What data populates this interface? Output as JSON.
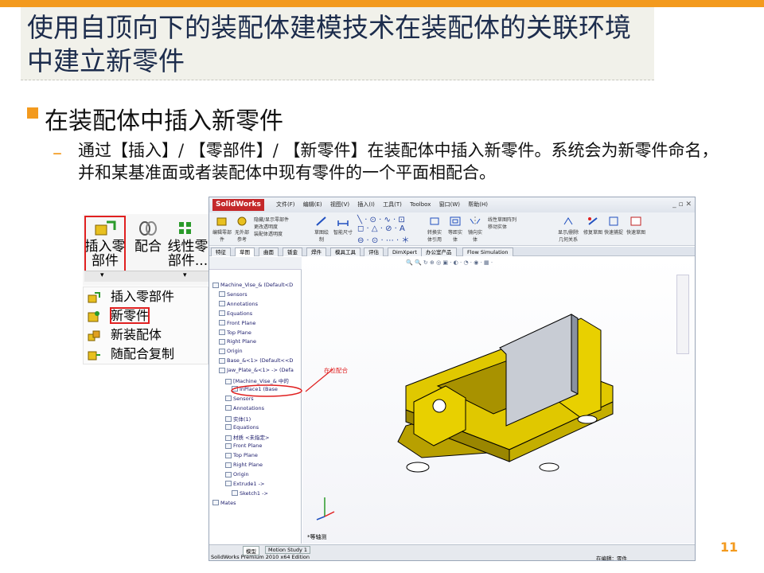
{
  "slide": {
    "title": "使用自顶向下的装配体建模技术在装配体的关联环境中建立新零件",
    "heading": "在装配体中插入新零件",
    "dash": "–",
    "paragraph": "通过【插入】/ 【零部件】/ 【新零件】在装配体中插入新零件。系统会为新零件命名，并和某基准面或者装配体中现有零件的一个平面相配合。",
    "page_number": "11",
    "accent_color": "#f39a1e"
  },
  "toolbar_panel": {
    "buttons": [
      {
        "label": "插入零\n部件",
        "icon": "insert-component-icon"
      },
      {
        "label": "配合",
        "icon": "mate-icon"
      },
      {
        "label": "线性零\n部件...",
        "icon": "linear-pattern-icon"
      }
    ],
    "menu_items": [
      {
        "label": "插入零部件",
        "icon": "insert-component-icon"
      },
      {
        "label": "新零件",
        "icon": "new-part-icon"
      },
      {
        "label": "新装配体",
        "icon": "new-assembly-icon"
      },
      {
        "label": "随配合复制",
        "icon": "copy-with-mates-icon"
      }
    ]
  },
  "solidworks": {
    "logo": "SolidWorks",
    "menu": [
      "文件(F)",
      "编辑(E)",
      "视图(V)",
      "插入(I)",
      "工具(T)",
      "Toolbox",
      "窗口(W)",
      "帮助(H)"
    ],
    "ribbon": [
      {
        "label": "编辑零部件",
        "icon": "edit-component-icon"
      },
      {
        "label": "无外部参考",
        "icon": "no-external-refs-icon"
      },
      {
        "label": "隐藏/显示零部件",
        "icon": "show-hide-icon"
      },
      {
        "label": "更改透明度",
        "icon": "transparency-icon"
      },
      {
        "label": "装配体透明度",
        "icon": "assembly-transparency-icon"
      },
      {
        "label": "草图绘制",
        "icon": "sketch-icon"
      },
      {
        "label": "智能尺寸",
        "icon": "smart-dimension-icon"
      },
      {
        "label": "转换实体引用",
        "icon": "convert-entities-icon"
      },
      {
        "label": "等距实体",
        "icon": "offset-entities-icon"
      },
      {
        "label": "镜向实体",
        "icon": "mirror-entities-icon"
      },
      {
        "label": "线性草图阵列",
        "icon": "linear-sketch-pattern-icon"
      },
      {
        "label": "移动实体",
        "icon": "move-entities-icon"
      },
      {
        "label": "显示/删除几何关系",
        "icon": "relations-icon"
      },
      {
        "label": "修复草图",
        "icon": "repair-sketch-icon"
      },
      {
        "label": "快速捕捉",
        "icon": "quick-snaps-icon"
      },
      {
        "label": "快速草图",
        "icon": "rapid-sketch-icon"
      }
    ],
    "tabs": [
      "特征",
      "草图",
      "曲面",
      "钣金",
      "焊件",
      "模具工具",
      "评估",
      "DimXpert",
      "办公室产品",
      "Flow Simulation"
    ],
    "active_tab": "草图",
    "tree": [
      {
        "label": "Machine_Vise_&  (Default<D",
        "indent": 0
      },
      {
        "label": "Sensors",
        "indent": 1
      },
      {
        "label": "Annotations",
        "indent": 1
      },
      {
        "label": "Equations",
        "indent": 1
      },
      {
        "label": "Front Plane",
        "indent": 1
      },
      {
        "label": "Top Plane",
        "indent": 1
      },
      {
        "label": "Right Plane",
        "indent": 1
      },
      {
        "label": "Origin",
        "indent": 1
      },
      {
        "label": "Base_&<1> (Default<<D",
        "indent": 1
      },
      {
        "label": "Jaw_Plate_&<1> -> (Defa",
        "indent": 1
      },
      {
        "label": "[Machine_Vise_& 中的",
        "indent": 2
      },
      {
        "label": "InPlace1 (Base",
        "indent": 3
      },
      {
        "label": "Sensors",
        "indent": 2
      },
      {
        "label": "Annotations",
        "indent": 2
      },
      {
        "label": "实体(1)",
        "indent": 2
      },
      {
        "label": "Equations",
        "indent": 2
      },
      {
        "label": "材质 <未指定>",
        "indent": 2
      },
      {
        "label": "Front Plane",
        "indent": 2
      },
      {
        "label": "Top Plane",
        "indent": 2
      },
      {
        "label": "Right Plane",
        "indent": 2
      },
      {
        "label": "Origin",
        "indent": 2
      },
      {
        "label": "Extrude1 ->",
        "indent": 2
      },
      {
        "label": "Sketch1 ->",
        "indent": 3
      },
      {
        "label": "Mates",
        "indent": 0
      }
    ],
    "annotation": "在位配合",
    "view_label": "*等轴测",
    "status_tabs": [
      "模型",
      "Motion Study 1"
    ],
    "status_left": "SolidWorks Premium 2010 x64 Edition",
    "status_right": "在编辑：零件"
  }
}
